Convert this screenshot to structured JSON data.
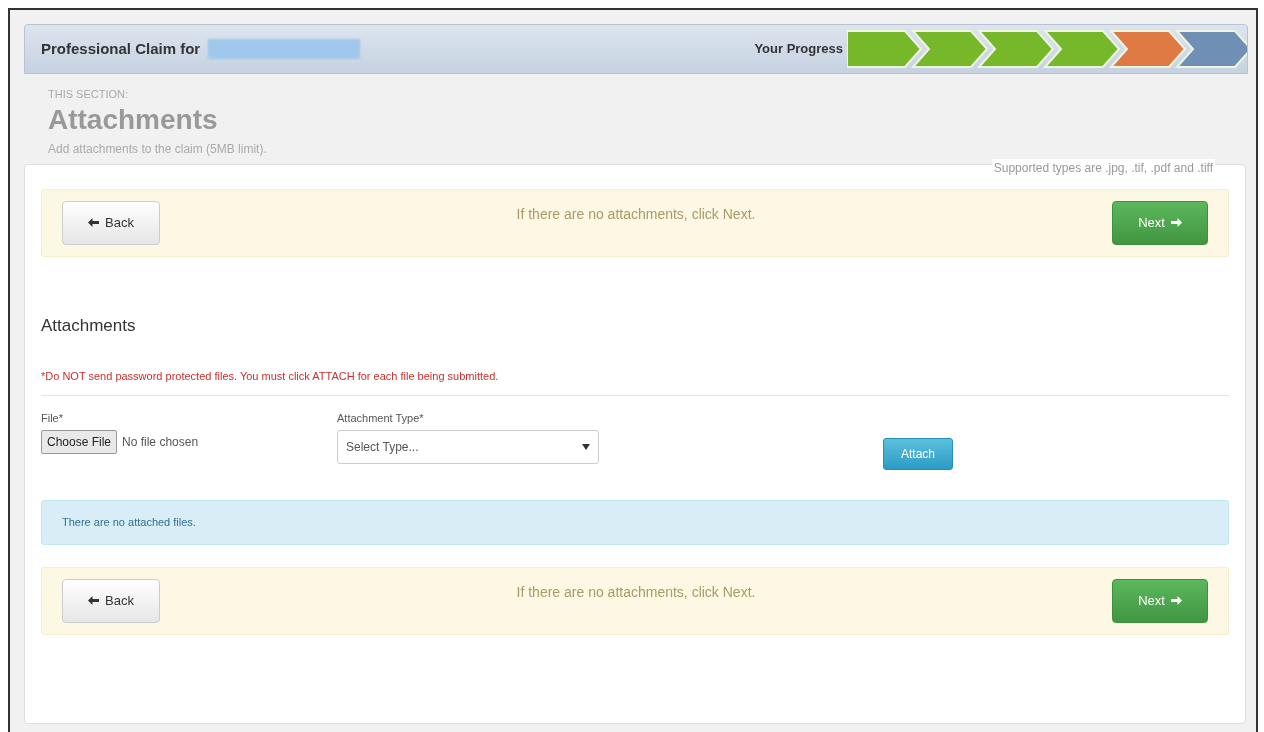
{
  "header": {
    "title": "Professional Claim for",
    "progress_label": "Your Progress",
    "progress_steps": [
      {
        "color": "#76b82a"
      },
      {
        "color": "#76b82a"
      },
      {
        "color": "#76b82a"
      },
      {
        "color": "#76b82a"
      },
      {
        "color": "#e07a45"
      },
      {
        "color": "#6f8fb5"
      }
    ]
  },
  "section": {
    "eyebrow": "THIS SECTION:",
    "title": "Attachments",
    "description": "Add attachments to the claim (5MB limit)."
  },
  "supported_types": "Supported types are .jpg, .tif, .pdf and .tiff",
  "nav_bars": [
    {
      "back": "Back",
      "message": "If there are no attachments, click Next.",
      "next": "Next"
    }
  ],
  "attachments": {
    "heading": "Attachments",
    "warning": "*Do NOT send password protected files. You must click ATTACH for each file being submitted.",
    "file_label": "File*",
    "choose_button": "Choose File",
    "file_status": "No file chosen",
    "type_label": "Attachment Type*",
    "type_placeholder": "Select Type...",
    "attach_button": "Attach",
    "empty_notice": "There are no attached files."
  },
  "bottom_nav": {
    "back": "Back",
    "message": "If there are no attachments, click Next.",
    "next": "Next"
  }
}
